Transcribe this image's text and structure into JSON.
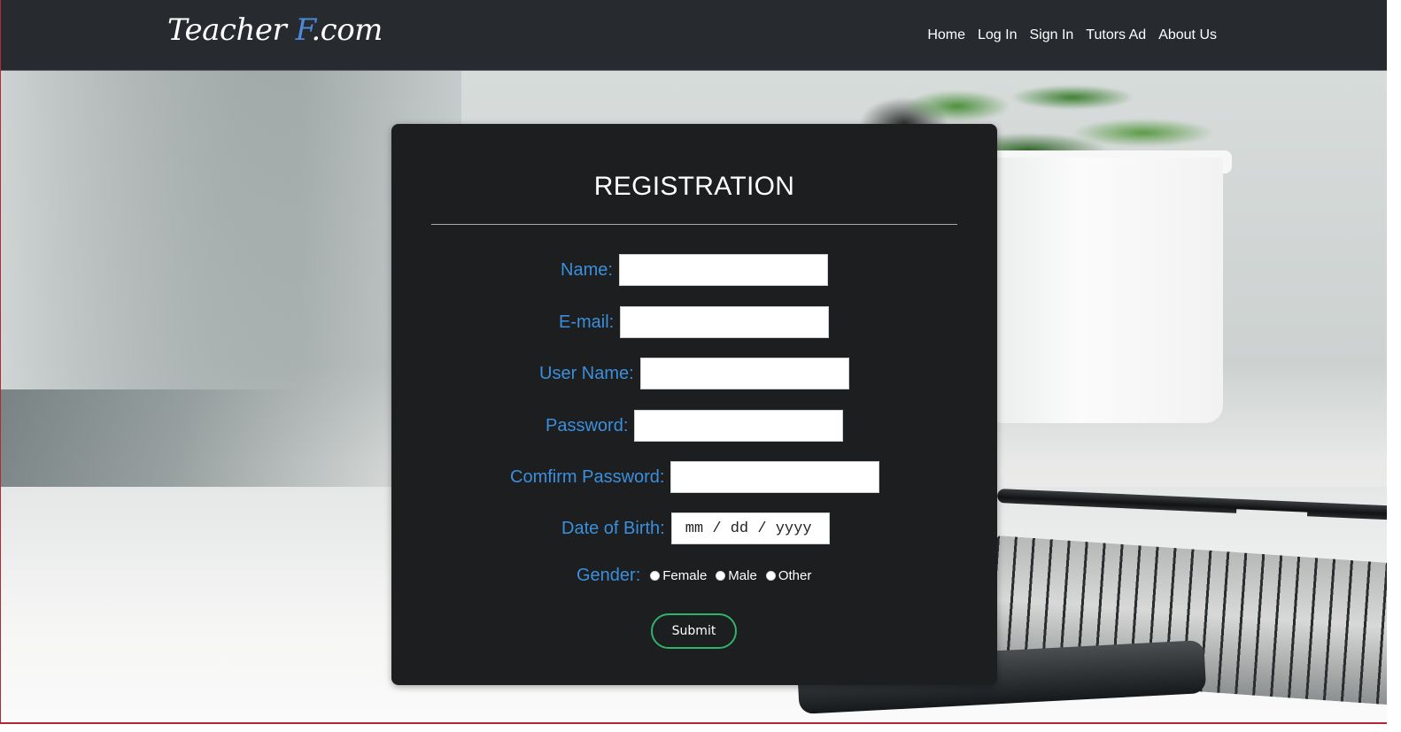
{
  "navbar": {
    "logo_main": "Teacher ",
    "logo_accent": "F",
    "logo_suffix": ".com",
    "links": [
      {
        "label": "Home"
      },
      {
        "label": "Log In"
      },
      {
        "label": "Sign In"
      },
      {
        "label": "Tutors Ad"
      },
      {
        "label": "About Us"
      }
    ]
  },
  "form": {
    "title": "REGISTRATION",
    "fields": {
      "name": {
        "label": "Name:",
        "value": ""
      },
      "email": {
        "label": "E-mail:",
        "value": ""
      },
      "username": {
        "label": "User Name:",
        "value": ""
      },
      "password": {
        "label": "Password:",
        "value": ""
      },
      "confirm_password": {
        "label": "Comfirm Password:",
        "value": ""
      },
      "dob": {
        "label": "Date of Birth:",
        "placeholder": "mm / dd / yyyy"
      }
    },
    "gender": {
      "label": "Gender:",
      "options": [
        {
          "label": "Female"
        },
        {
          "label": "Male"
        },
        {
          "label": "Other"
        }
      ]
    },
    "submit_label": "Submit"
  },
  "colors": {
    "navbar_bg": "#272b2f",
    "card_bg": "#1d1e1f",
    "label_blue": "#3b8fdc",
    "button_border_green": "#2fb36d",
    "frame_red": "#b5283a",
    "logo_accent": "#4d89d6"
  }
}
